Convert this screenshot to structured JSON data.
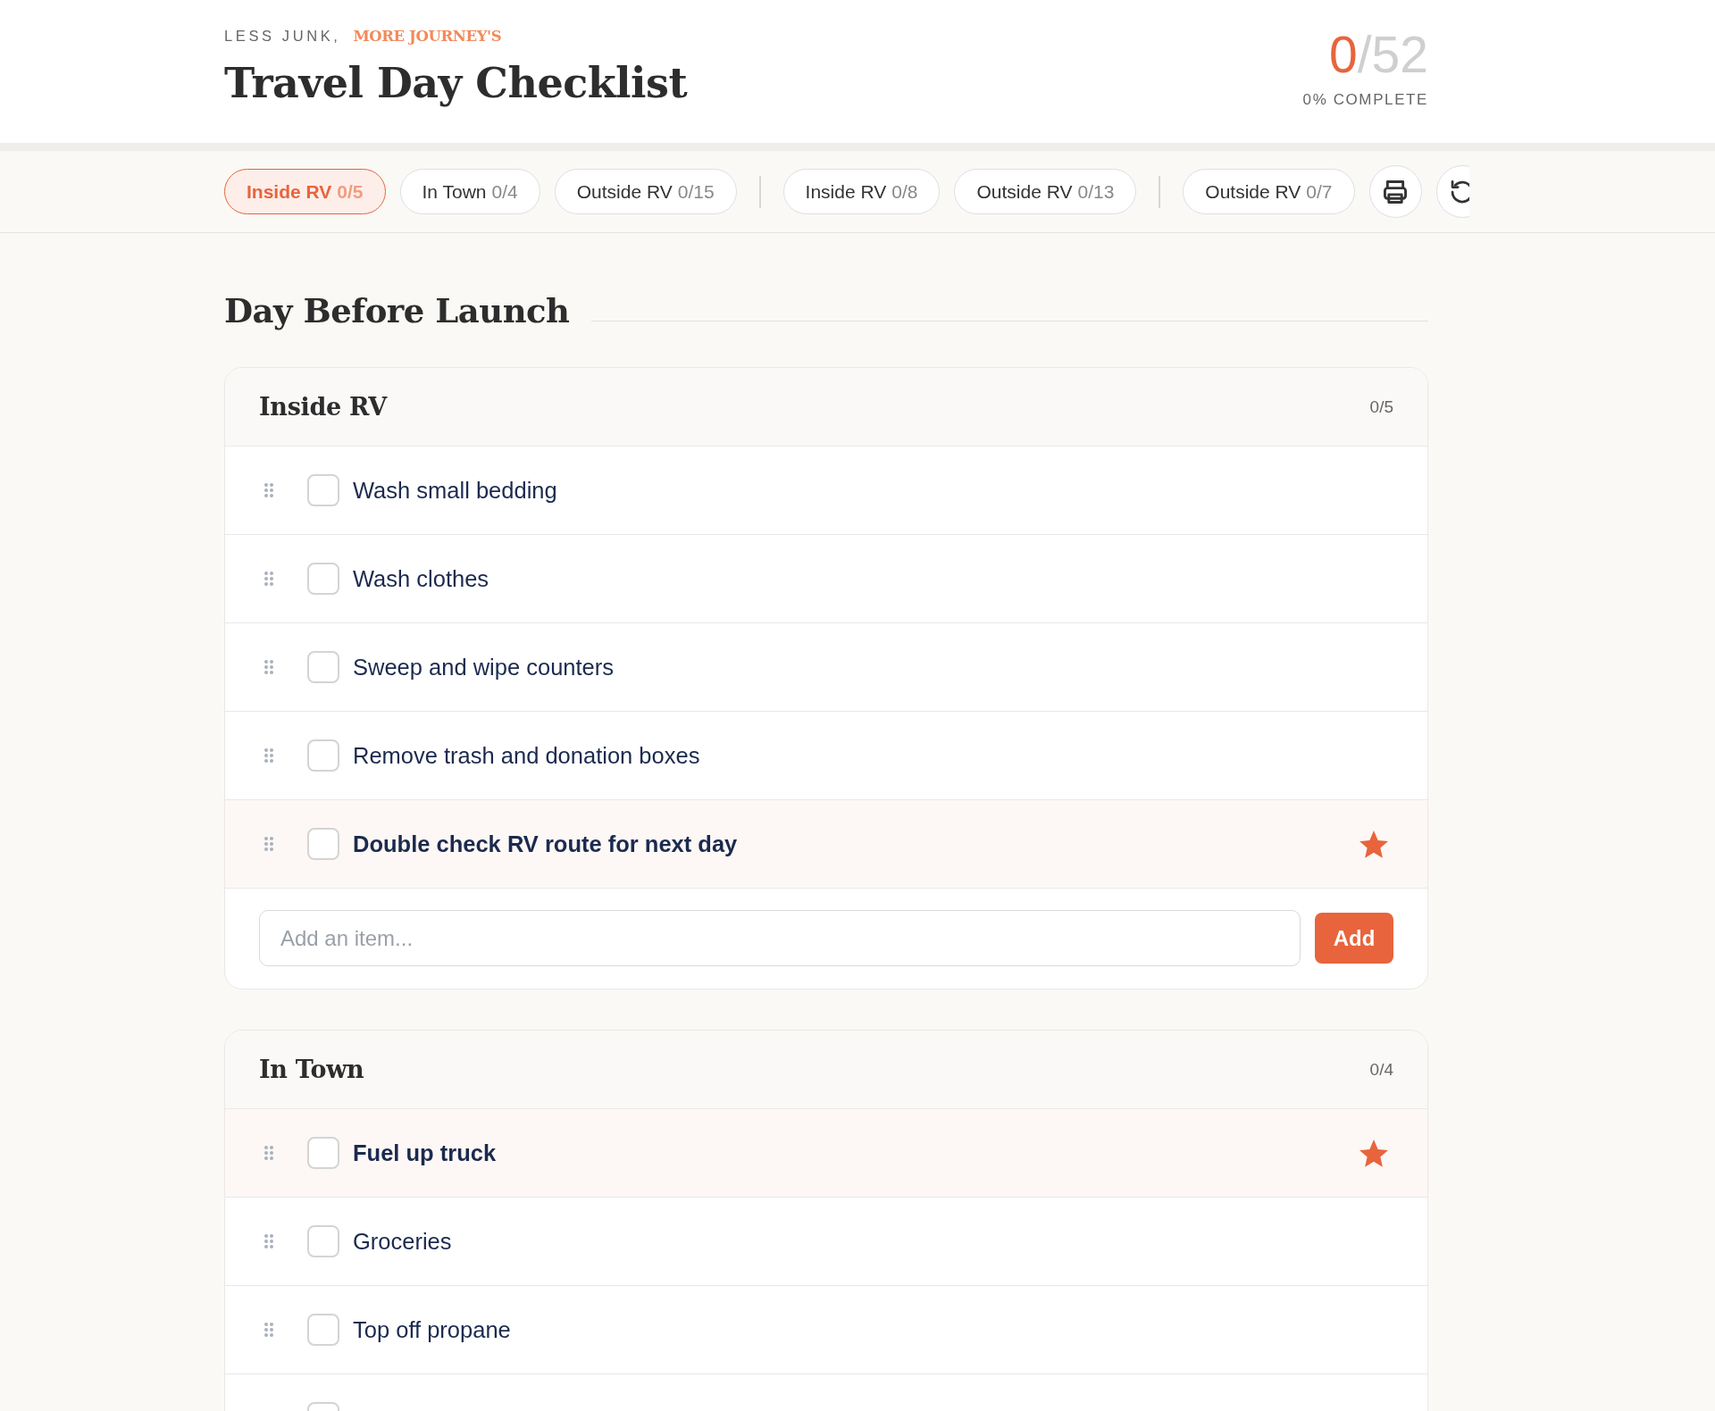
{
  "header": {
    "tagline": "LESS JUNK,",
    "tagline_accent": "MORE JOURNEY'S",
    "title": "Travel Day Checklist",
    "progress": {
      "done": "0",
      "of_total": "/52",
      "caption": "0% COMPLETE"
    }
  },
  "tab_groups": [
    {
      "tabs": [
        {
          "label": "Inside RV",
          "count": "0/5",
          "selected": true
        },
        {
          "label": "In Town",
          "count": "0/4",
          "selected": false
        },
        {
          "label": "Outside RV",
          "count": "0/15",
          "selected": false
        }
      ]
    },
    {
      "tabs": [
        {
          "label": "Inside RV",
          "count": "0/8",
          "selected": false
        },
        {
          "label": "Outside RV",
          "count": "0/13",
          "selected": false
        }
      ]
    },
    {
      "tabs": [
        {
          "label": "Outside RV",
          "count": "0/7",
          "selected": false
        }
      ]
    }
  ],
  "sections": [
    {
      "title": "Day Before Launch",
      "cards": [
        {
          "title": "Inside RV",
          "count": "0/5",
          "items": [
            {
              "label": "Wash small bedding",
              "checked": false,
              "starred": false
            },
            {
              "label": "Wash clothes",
              "checked": false,
              "starred": false
            },
            {
              "label": "Sweep and wipe counters",
              "checked": false,
              "starred": false
            },
            {
              "label": "Remove trash and donation boxes",
              "checked": false,
              "starred": false
            },
            {
              "label": "Double check RV route for next day",
              "checked": false,
              "starred": true
            }
          ],
          "add_field": {
            "placeholder": "Add an item...",
            "button": "Add"
          }
        },
        {
          "title": "In Town",
          "count": "0/4",
          "items": [
            {
              "label": "Fuel up truck",
              "checked": false,
              "starred": true
            },
            {
              "label": "Groceries",
              "checked": false,
              "starred": false
            },
            {
              "label": "Top off propane",
              "checked": false,
              "starred": false
            },
            {
              "checked": false,
              "starred": false
            }
          ]
        }
      ]
    }
  ]
}
